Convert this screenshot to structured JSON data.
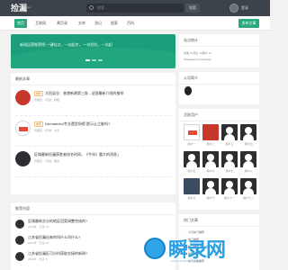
{
  "header": {
    "logo": "捡漏",
    "logo_sub": "jianlou",
    "search_placeholder": "搜索...",
    "go_label": "搜索",
    "user_label": "登录"
  },
  "nav": {
    "items": [
      "首页",
      "互联网",
      "黄页录",
      "文库",
      "游记",
      "搜索",
      "百科"
    ],
    "post_button": "发布文章"
  },
  "banner": {
    "text": "新锐运营推荐榜·一键站点，一站起步，·一站到位，一站起·"
  },
  "latest": {
    "title": "最新文章",
    "posts": [
      {
        "tag": "推荐",
        "title": "大田县业：香港新建第三批...全国最新介绍的推举",
        "meta": "管理员 · 2天前 · 教程"
      },
      {
        "tag": "推荐",
        "title": "Dermaholot专业遗型场馆·提示让之能吗?",
        "meta": "管理员 · 2天前 · 分享"
      },
      {
        "tag": "",
        "title": "区域最新捡漏获胜者排名时间，《今年》重大的消息」",
        "meta": "管理员 · 2天前 · 服务"
      }
    ]
  },
  "recommend": {
    "title": "推荐内容",
    "items": [
      {
        "title": "区域最新交分的地区回案调整完成的?",
        "meta": "2024年 · 已读: 12"
      },
      {
        "title": "江苏省捡漏出来的叫什么叫什么?",
        "meta": "2024年 · 已读: 10"
      },
      {
        "title": "江苏省捡漏区可分时获取交接的新闻?",
        "meta": "2024年 · 已读: 8"
      }
    ]
  },
  "site_info": {
    "title": "站点统计",
    "line1": "文章: 8  评论: 0  用户: 11",
    "line2": "Powered by wordpress"
  },
  "side_ad": {
    "title": "公司简介"
  },
  "users": {
    "title": "活跃用户",
    "names": [
      "用户一",
      "用户二",
      "用户三",
      "用户四",
      "用户五",
      "用户六",
      "用户七",
      "用户八",
      "用户九",
      "用户十",
      "用户十一",
      "用户十二"
    ]
  },
  "hot": {
    "title": "热门文章",
    "items": [
      "今日热门推荐",
      "热门推荐",
      "热门推荐 (第一篇)",
      "推荐文章",
      "热门文章推荐"
    ]
  },
  "watermark": {
    "text": "瞬录网",
    "url": "www.shunlu.com"
  },
  "colors": {
    "accent": "#2aa87e",
    "topbar": "#3d434a"
  }
}
